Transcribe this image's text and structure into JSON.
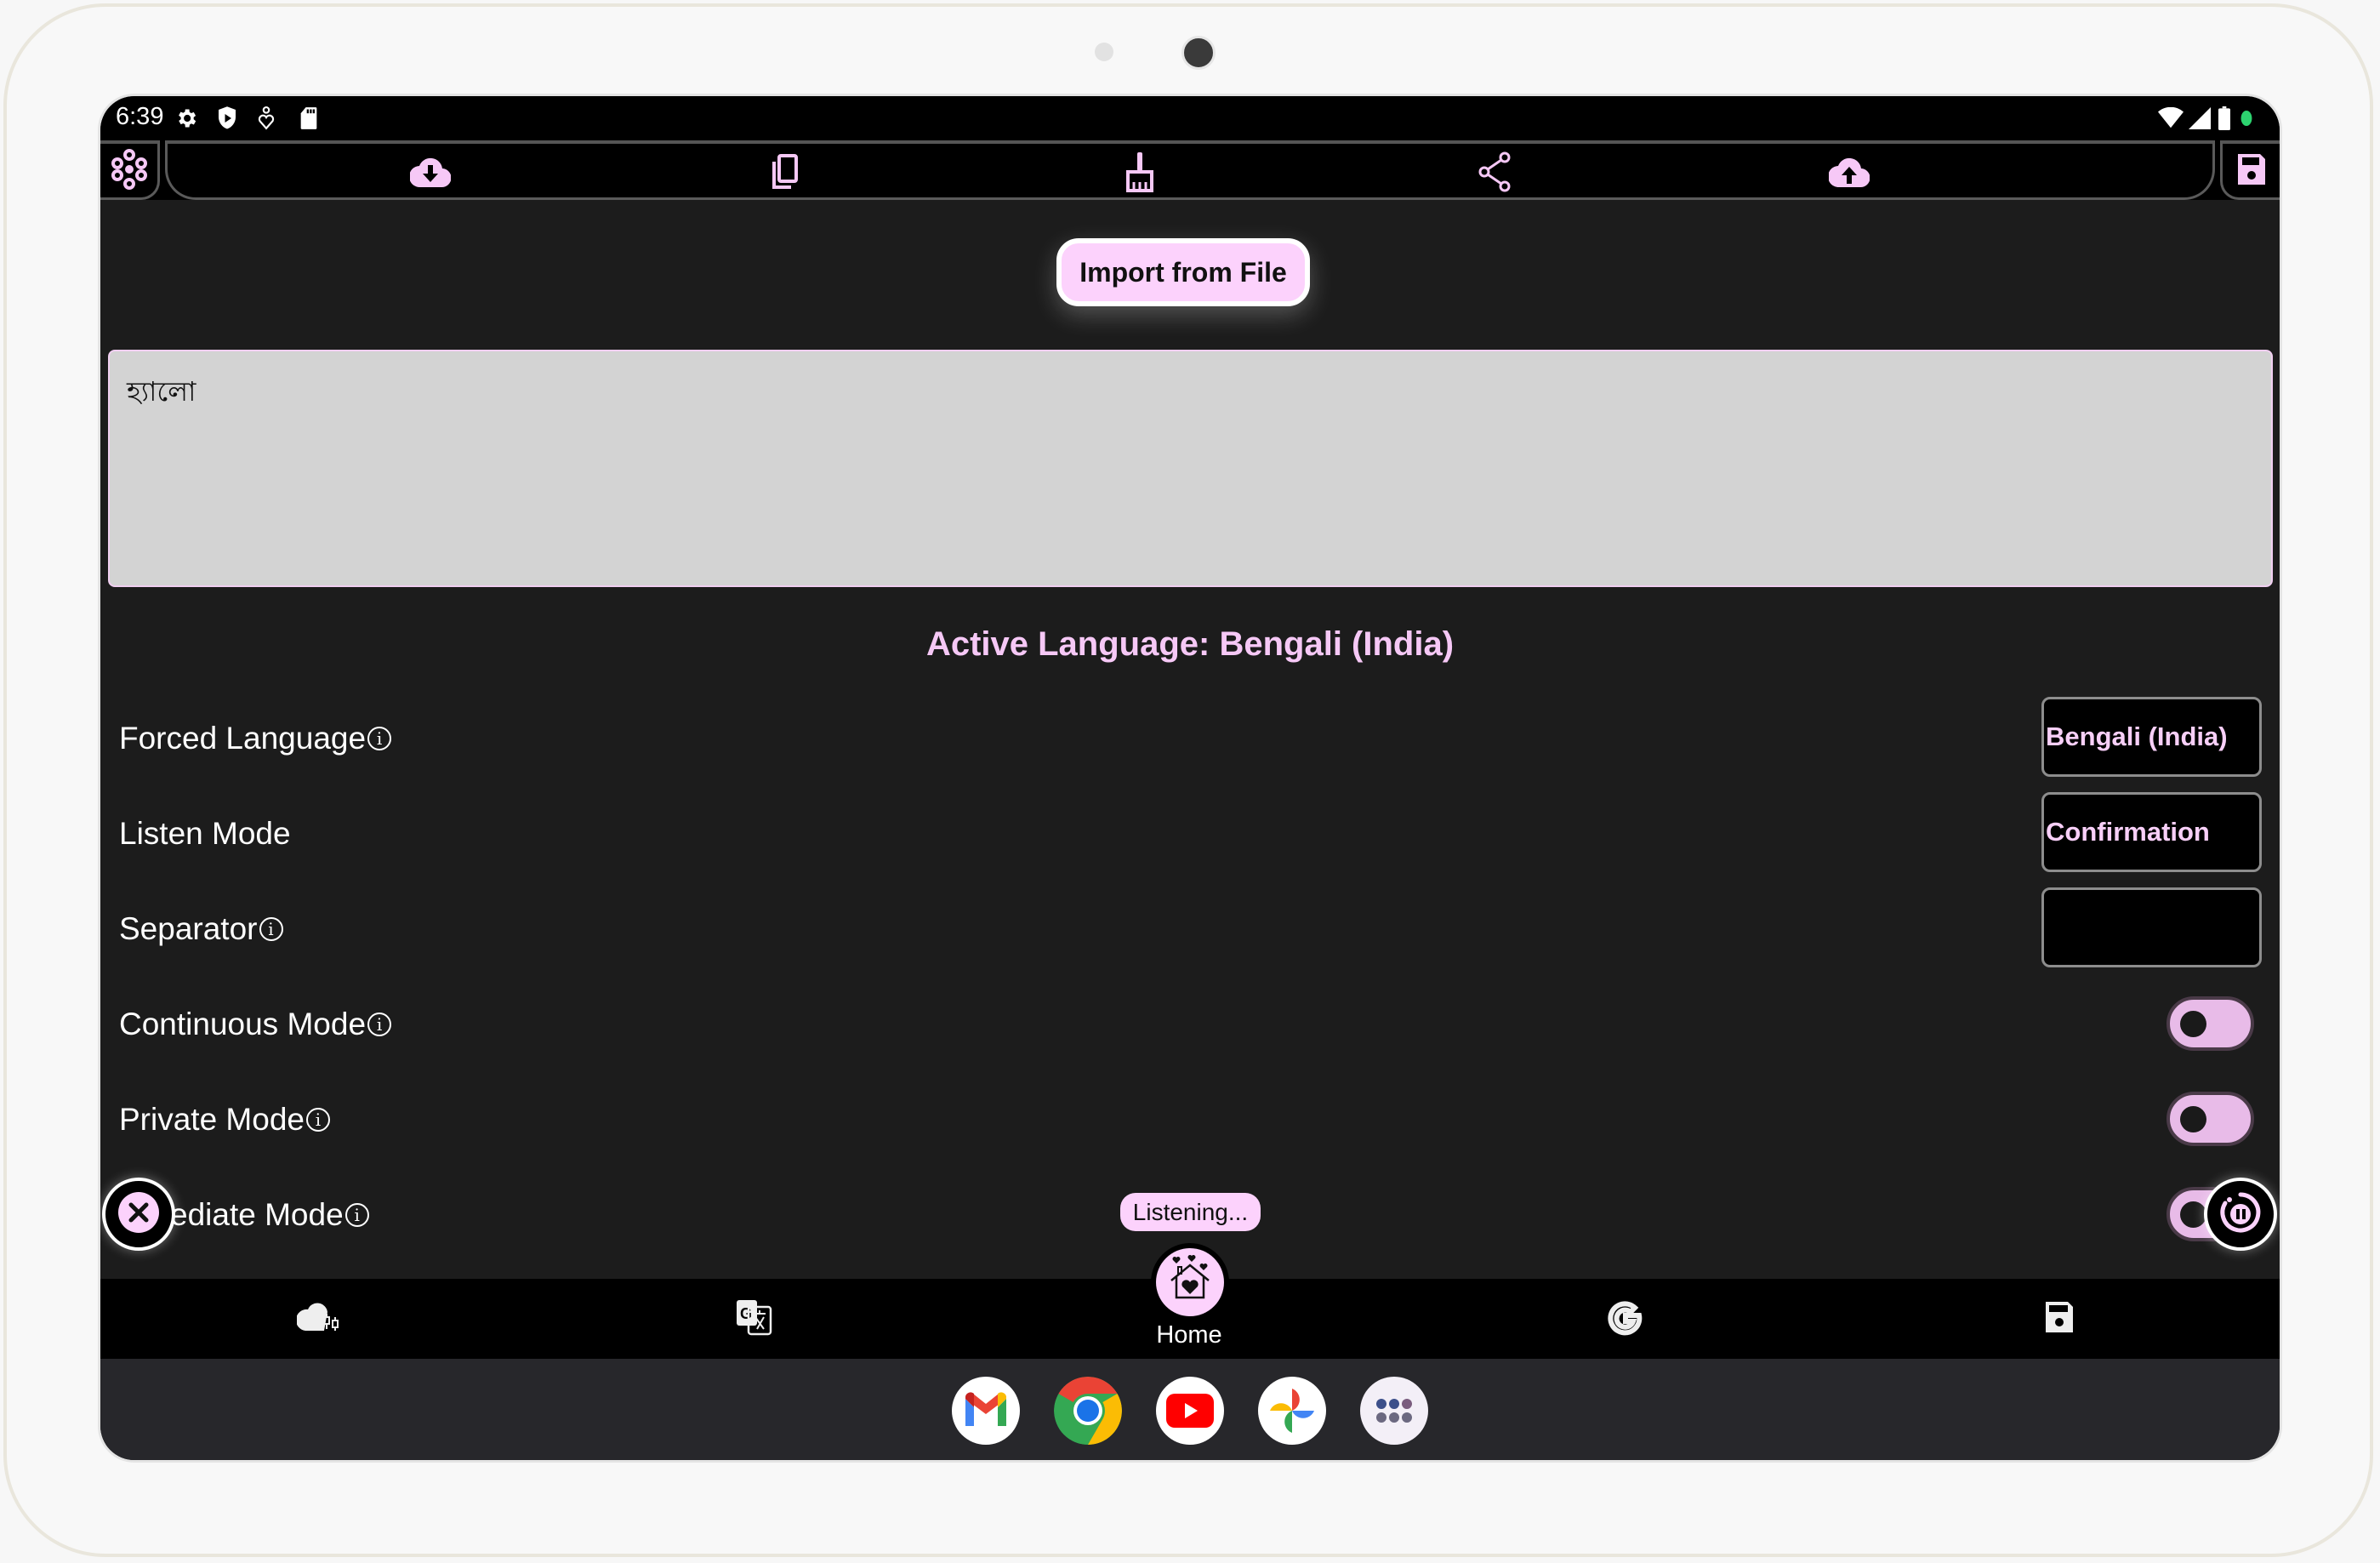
{
  "status_bar": {
    "time": "6:39",
    "left_icons": [
      "gear-icon",
      "play-protect-shield-icon",
      "accessibility-heart-icon",
      "sd-card-icon"
    ],
    "right_icons": [
      "wifi-icon",
      "cellular-signal-icon",
      "battery-icon",
      "mic-active-dot-icon"
    ]
  },
  "toolbar": {
    "left_icon": "flower-menu-icon",
    "items": [
      {
        "name": "cloud-download",
        "icon": "cloud-download-icon"
      },
      {
        "name": "copy",
        "icon": "copy-icon"
      },
      {
        "name": "clear",
        "icon": "broom-icon"
      },
      {
        "name": "share",
        "icon": "share-icon"
      },
      {
        "name": "cloud-upload",
        "icon": "cloud-upload-icon"
      }
    ],
    "right_icon": "save-icon"
  },
  "import_button": {
    "label": "Import from File"
  },
  "transcript": {
    "value": "হ্যালো"
  },
  "active_language": "Active Language: Bengali (India)",
  "settings": [
    {
      "label": "Forced Language",
      "info": true,
      "type": "field",
      "value": "Bengali (India)"
    },
    {
      "label": "Listen Mode",
      "info": false,
      "type": "field",
      "value": "Confirmation"
    },
    {
      "label": "Separator",
      "info": true,
      "type": "field",
      "value": ""
    },
    {
      "label": "Continuous Mode",
      "info": true,
      "type": "toggle",
      "checked": false
    },
    {
      "label": "Private Mode",
      "info": true,
      "type": "toggle",
      "checked": false
    },
    {
      "label": "Immediate Mode",
      "visible_label": "ediate Mode",
      "info": true,
      "type": "toggle",
      "checked": false
    }
  ],
  "info_glyph": "i",
  "listening_badge": "Listening...",
  "fabs": {
    "left": "close-icon",
    "right": "pause-listening-icon"
  },
  "bottom_nav": {
    "items": [
      {
        "icon": "cloud-settings-icon"
      },
      {
        "icon": "google-translate-icon"
      },
      {
        "icon": "home-hearts-icon",
        "label": "Home",
        "active": true
      },
      {
        "icon": "google-g-icon"
      },
      {
        "icon": "save-icon"
      }
    ]
  },
  "dock": {
    "apps": [
      "Gmail",
      "Chrome",
      "YouTube",
      "Google Photos",
      "App Drawer"
    ]
  },
  "colors": {
    "accent": "#fcd2fc",
    "background": "#1c1c1c",
    "toolbar": "#000000",
    "textarea": "#d3d3d3"
  }
}
